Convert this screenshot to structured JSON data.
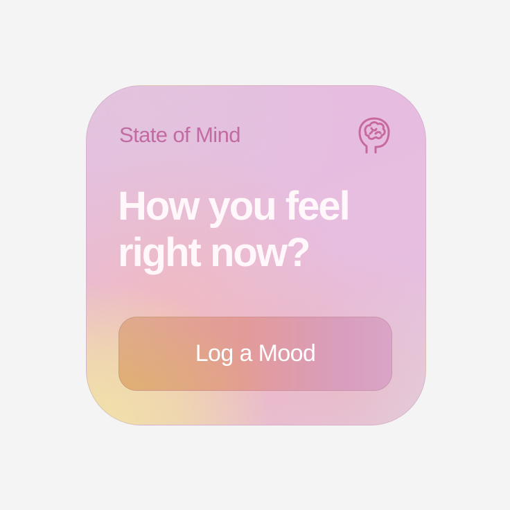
{
  "widget": {
    "title": "State of Mind",
    "icon": "brain-head-icon",
    "headline": {
      "line1": "How you feel",
      "line2": "right now?"
    },
    "button_label": "Log a Mood"
  },
  "colors": {
    "page_background": "#f4f4f4",
    "title": "#c26ba2",
    "icon": "#c8699e",
    "headline": "#fff7fa",
    "button_text": "#ffffff"
  }
}
